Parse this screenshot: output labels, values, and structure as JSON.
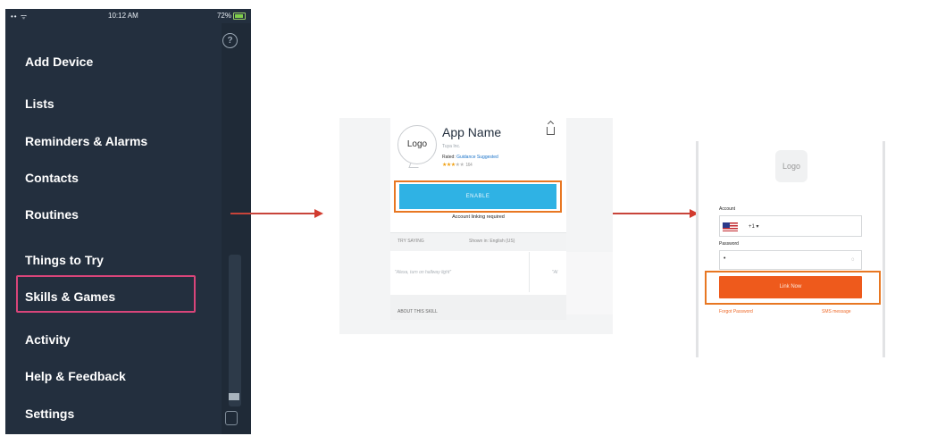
{
  "status_bar": {
    "signal": "•• ᯤ",
    "time": "10:12 AM",
    "battery": "72%"
  },
  "menu": {
    "help_icon": "?",
    "items": [
      "Add Device",
      "Lists",
      "Reminders & Alarms",
      "Contacts",
      "Routines",
      "Things to Try",
      "Skills & Games",
      "Activity",
      "Help & Feedback",
      "Settings"
    ],
    "highlighted_item": "Skills & Games"
  },
  "skill_page": {
    "logo": "Logo",
    "app_name": "App Name",
    "publisher": "Tuya Inc.",
    "rated_label": "Rated:",
    "rating": "Guidance Suggested",
    "stars": "★★★",
    "stars_empty": "★★",
    "review_count": "164",
    "enable_button": "ENABLE",
    "account_linking": "Account linking required",
    "try_saying": "TRY SAYING",
    "shown_in": "Shown in: English (US)",
    "quote_1": "\"Alexa, turn on hallway light\"",
    "quote_2": "\"Al",
    "about": "ABOUT THIS SKILL"
  },
  "login_page": {
    "logo": "Logo",
    "account_label": "Account",
    "country_code": "+1 ▾",
    "password_label": "Password",
    "password_value": "•",
    "eye_icon": "◌",
    "link_button": "Link Now",
    "forgot_password": "Forgot Password",
    "sms_message": "SMS message"
  },
  "colors": {
    "menu_bg": "#232f3e",
    "menu_highlight": "#d9457a",
    "enable_blue": "#2fb2e4",
    "link_orange": "#ee5a1c",
    "highlight_orange": "#e87722",
    "arrow_red": "#d23b2f"
  }
}
